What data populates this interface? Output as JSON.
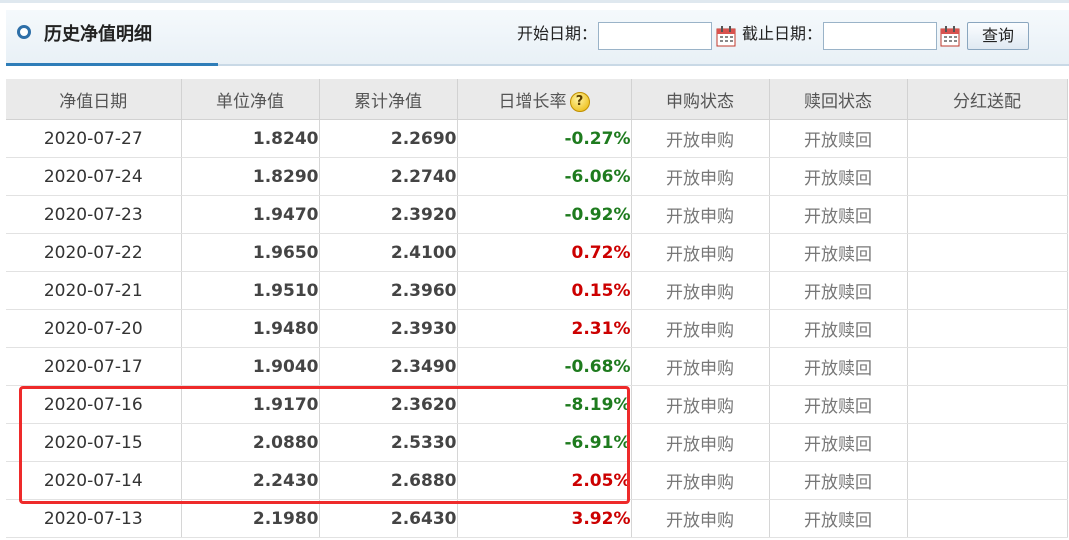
{
  "header": {
    "title": "历史净值明细",
    "start_date_label": "开始日期：",
    "start_date_value": "",
    "end_date_label": "截止日期：",
    "end_date_value": "",
    "query_label": "查询"
  },
  "table": {
    "columns": [
      "净值日期",
      "单位净值",
      "累计净值",
      "日增长率",
      "申购状态",
      "赎回状态",
      "分红送配"
    ],
    "rows": [
      {
        "date": "2020-07-27",
        "unit": "1.8240",
        "total": "2.2690",
        "rate": "-0.27%",
        "buy": "开放申购",
        "redeem": "开放赎回",
        "dividend": ""
      },
      {
        "date": "2020-07-24",
        "unit": "1.8290",
        "total": "2.2740",
        "rate": "-6.06%",
        "buy": "开放申购",
        "redeem": "开放赎回",
        "dividend": ""
      },
      {
        "date": "2020-07-23",
        "unit": "1.9470",
        "total": "2.3920",
        "rate": "-0.92%",
        "buy": "开放申购",
        "redeem": "开放赎回",
        "dividend": ""
      },
      {
        "date": "2020-07-22",
        "unit": "1.9650",
        "total": "2.4100",
        "rate": "0.72%",
        "buy": "开放申购",
        "redeem": "开放赎回",
        "dividend": ""
      },
      {
        "date": "2020-07-21",
        "unit": "1.9510",
        "total": "2.3960",
        "rate": "0.15%",
        "buy": "开放申购",
        "redeem": "开放赎回",
        "dividend": ""
      },
      {
        "date": "2020-07-20",
        "unit": "1.9480",
        "total": "2.3930",
        "rate": "2.31%",
        "buy": "开放申购",
        "redeem": "开放赎回",
        "dividend": ""
      },
      {
        "date": "2020-07-17",
        "unit": "1.9040",
        "total": "2.3490",
        "rate": "-0.68%",
        "buy": "开放申购",
        "redeem": "开放赎回",
        "dividend": ""
      },
      {
        "date": "2020-07-16",
        "unit": "1.9170",
        "total": "2.3620",
        "rate": "-8.19%",
        "buy": "开放申购",
        "redeem": "开放赎回",
        "dividend": ""
      },
      {
        "date": "2020-07-15",
        "unit": "2.0880",
        "total": "2.5330",
        "rate": "-6.91%",
        "buy": "开放申购",
        "redeem": "开放赎回",
        "dividend": ""
      },
      {
        "date": "2020-07-14",
        "unit": "2.2430",
        "total": "2.6880",
        "rate": "2.05%",
        "buy": "开放申购",
        "redeem": "开放赎回",
        "dividend": ""
      },
      {
        "date": "2020-07-13",
        "unit": "2.1980",
        "total": "2.6430",
        "rate": "3.92%",
        "buy": "开放申购",
        "redeem": "开放赎回",
        "dividend": ""
      }
    ]
  },
  "colors": {
    "up": "#cc0000",
    "down": "#1e7b1e",
    "highlight_border": "#ee2a2a",
    "accent": "#2e7db8"
  },
  "icons": {
    "title_marker": "circle-icon",
    "date_picker": "calendar-icon",
    "rate_help": "help-icon"
  }
}
